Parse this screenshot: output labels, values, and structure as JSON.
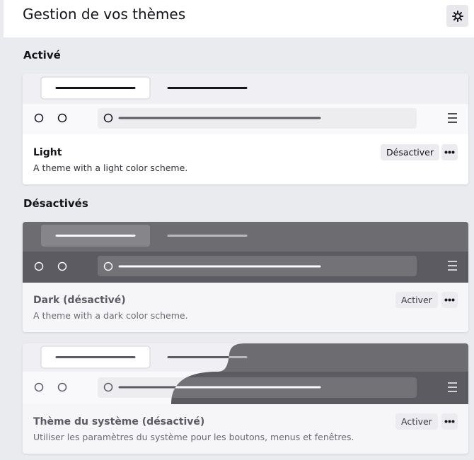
{
  "header": {
    "title": "Gestion de vos thèmes",
    "settings_icon": "gear-icon"
  },
  "sections": {
    "active": {
      "label": "Activé"
    },
    "inactive": {
      "label": "Désactivés"
    }
  },
  "themes": [
    {
      "name": "Light",
      "description": "A theme with a light color scheme.",
      "action": "Désactiver",
      "more_icon": "more-icon"
    },
    {
      "name": "Dark (désactivé)",
      "description": "A theme with a dark color scheme.",
      "action": "Activer",
      "more_icon": "more-icon"
    },
    {
      "name": "Thème du système (désactivé)",
      "description": "Utiliser les paramètres du système pour les boutons, menus et fenêtres.",
      "action": "Activer",
      "more_icon": "more-icon"
    }
  ],
  "colors": {
    "page_bg": "#e9ebef",
    "light_tabstrip": "#f0f0f4",
    "dark_tabstrip": "#6c6c71",
    "dark_toolbar": "#5b5b61",
    "dark_urlbar": "#727277"
  }
}
